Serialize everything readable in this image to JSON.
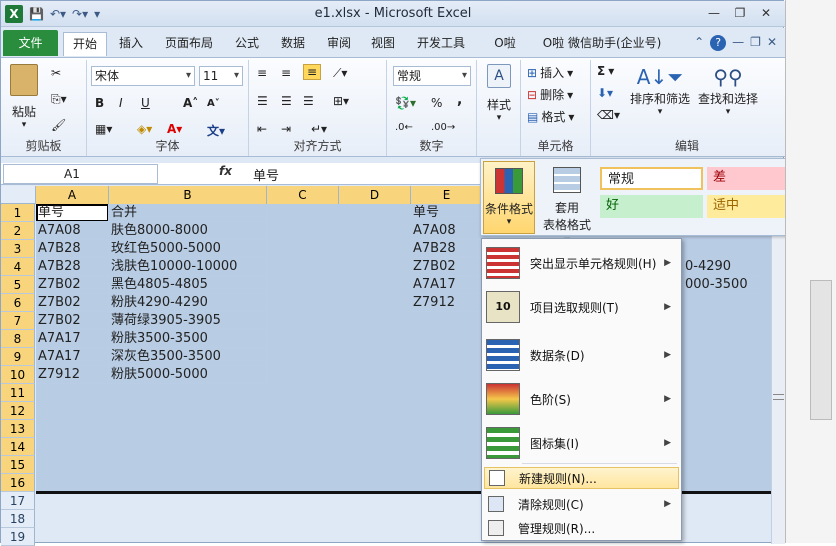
{
  "window": {
    "title": "e1.xlsx - Microsoft Excel"
  },
  "tabs": [
    "文件",
    "开始",
    "插入",
    "页面布局",
    "公式",
    "数据",
    "审阅",
    "视图",
    "开发工具",
    "O啦",
    "O啦 微信助手(企业号)"
  ],
  "ribbon": {
    "clipboard": {
      "paste": "粘贴",
      "group": "剪贴板"
    },
    "font": {
      "name": "宋体",
      "size": "11",
      "group": "字体",
      "bold": "B",
      "italic": "I",
      "underline": "U"
    },
    "alignment": {
      "group": "对齐方式"
    },
    "number": {
      "format": "常规",
      "group": "数字",
      "percent": "%",
      "comma": ","
    },
    "styles": {
      "label": "样式"
    },
    "cells": {
      "insert": "插入",
      "delete": "删除",
      "format": "格式",
      "group": "单元格"
    },
    "editing": {
      "sort": "排序和筛选",
      "find": "查找和选择",
      "group": "编辑",
      "sigma": "Σ"
    }
  },
  "formula_bar": {
    "name_box": "A1",
    "fx": "fx",
    "value": "单号"
  },
  "columns": [
    "A",
    "B",
    "C",
    "D",
    "E"
  ],
  "rows": [
    "1",
    "2",
    "3",
    "4",
    "5",
    "6",
    "7",
    "8",
    "9",
    "10",
    "11",
    "12",
    "13",
    "14",
    "15",
    "16",
    "17",
    "18",
    "19"
  ],
  "cells": {
    "A": [
      "单号",
      "A7A08",
      "A7B28",
      "A7B28",
      "Z7B02",
      "Z7B02",
      "Z7B02",
      "A7A17",
      "A7A17",
      "Z7912"
    ],
    "B": [
      "合并",
      "肤色8000-8000",
      "玫红色5000-5000",
      "浅肤色10000-10000",
      "黑色4805-4805",
      "粉肤4290-4290",
      "薄荷绿3905-3905",
      "粉肤3500-3500",
      "深灰色3500-3500",
      "粉肤5000-5000"
    ],
    "E": [
      "单号",
      "A7A08",
      "A7B28",
      "Z7B02",
      "A7A17",
      "Z7912"
    ],
    "F_partial": [
      "0-4290",
      "000-3500"
    ]
  },
  "style_gallery": {
    "conditional_formatting": "条件格式",
    "format_as_table_line1": "套用",
    "format_as_table_line2": "表格格式",
    "styles": [
      {
        "label": "常规",
        "bg": "#ffffff",
        "color": "#000000"
      },
      {
        "label": "差",
        "bg": "#ffc7ce",
        "color": "#9c0006"
      },
      {
        "label": "好",
        "bg": "#c6efce",
        "color": "#006100"
      },
      {
        "label": "适中",
        "bg": "#ffeb9c",
        "color": "#9c6500"
      }
    ]
  },
  "cf_menu": {
    "items": [
      {
        "label": "突出显示单元格规则(H)",
        "arrow": "▶"
      },
      {
        "label": "项目选取规则(T)",
        "arrow": "▶"
      },
      {
        "label": "数据条(D)",
        "arrow": "▶"
      },
      {
        "label": "色阶(S)",
        "arrow": "▶"
      },
      {
        "label": "图标集(I)",
        "arrow": "▶"
      },
      {
        "label": "新建规则(N)..."
      },
      {
        "label": "清除规则(C)",
        "arrow": "▶"
      },
      {
        "label": "管理规则(R)..."
      }
    ]
  }
}
